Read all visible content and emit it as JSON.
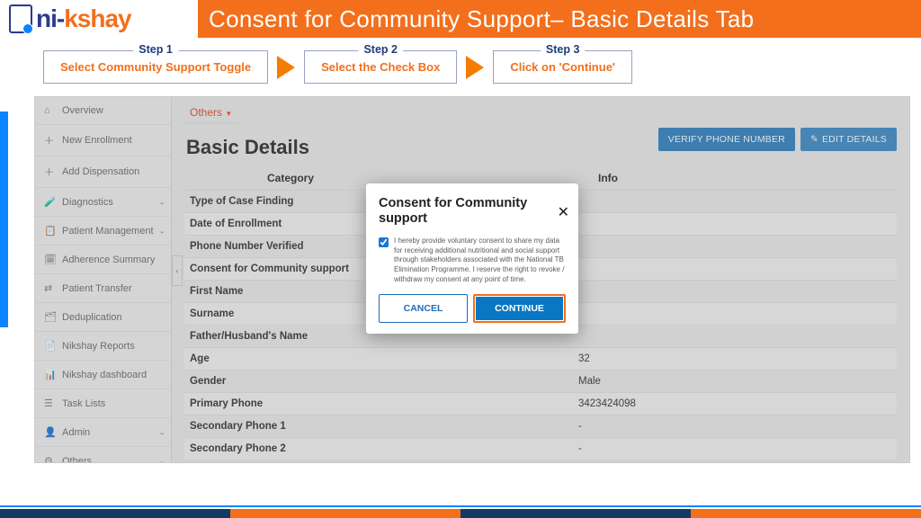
{
  "header": {
    "logo_text_pre": "ni-",
    "logo_text_post": "kshay",
    "title": "Consent for Community Support– Basic Details Tab"
  },
  "steps": [
    {
      "label": "Step 1",
      "text": "Select Community Support Toggle"
    },
    {
      "label": "Step 2",
      "text": "Select the Check Box"
    },
    {
      "label": "Step 3",
      "text": "Click on 'Continue'"
    }
  ],
  "sidebar": {
    "items": [
      {
        "icon": "⌂",
        "label": "Overview"
      },
      {
        "icon": "＋",
        "label": "New Enrollment"
      },
      {
        "icon": "＋",
        "label": "Add Dispensation"
      },
      {
        "icon": "🧪",
        "label": "Diagnostics",
        "chev": true
      },
      {
        "icon": "📋",
        "label": "Patient Management",
        "chev": true
      },
      {
        "icon": "🗓",
        "label": "Adherence Summary"
      },
      {
        "icon": "⇄",
        "label": "Patient Transfer"
      },
      {
        "icon": "🗂",
        "label": "Deduplication"
      },
      {
        "icon": "📄",
        "label": "Nikshay Reports"
      },
      {
        "icon": "📊",
        "label": "Nikshay dashboard"
      },
      {
        "icon": "☰",
        "label": "Task Lists"
      },
      {
        "icon": "👤",
        "label": "Admin",
        "chev": true
      },
      {
        "icon": "⚙",
        "label": "Others",
        "chev": true
      }
    ]
  },
  "main": {
    "tab": "Others",
    "page_title": "Basic Details",
    "buttons": {
      "verify": "VERIFY PHONE NUMBER",
      "edit": "EDIT DETAILS"
    },
    "headers": {
      "cat": "Category",
      "info": "Info"
    },
    "rows": [
      {
        "cat": "Type of Case Finding",
        "info": ""
      },
      {
        "cat": "Date of Enrollment",
        "info": ""
      },
      {
        "cat": "Phone Number Verified",
        "info": ""
      },
      {
        "cat": "Consent for Community support",
        "info": ""
      },
      {
        "cat": "First Name",
        "info": ""
      },
      {
        "cat": "Surname",
        "info": ""
      },
      {
        "cat": "Father/Husband's Name",
        "info": ""
      },
      {
        "cat": "Age",
        "info": "32"
      },
      {
        "cat": "Gender",
        "info": "Male"
      },
      {
        "cat": "Primary Phone",
        "info": "3423424098"
      },
      {
        "cat": "Secondary Phone 1",
        "info": "-"
      },
      {
        "cat": "Secondary Phone 2",
        "info": "-"
      }
    ]
  },
  "modal": {
    "title": "Consent for Community support",
    "text": "I hereby provide voluntary consent to share my data for receiving additional nutritional and social support through stakeholders associated with the National TB Elimination Programme. I reserve the right to revoke / withdraw my consent at any point of time.",
    "cancel": "CANCEL",
    "continue": "CONTINUE"
  }
}
